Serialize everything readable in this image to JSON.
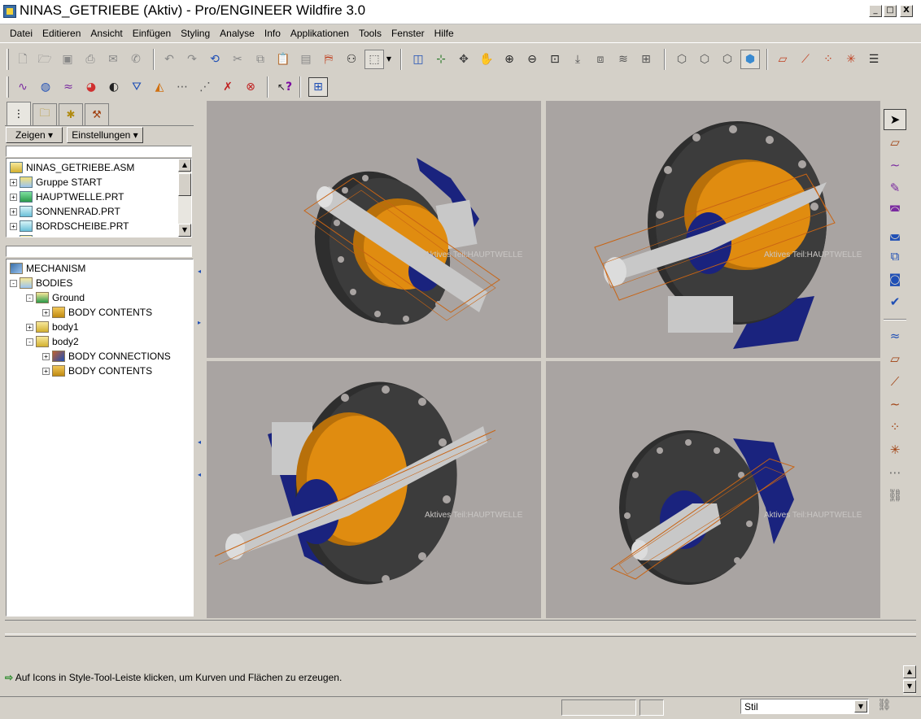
{
  "window": {
    "title": "NINAS_GETRIEBE (Aktiv) - Pro/ENGINEER Wildfire 3.0",
    "controls": [
      "_",
      "□",
      "X"
    ]
  },
  "menubar": [
    "Datei",
    "Editieren",
    "Ansicht",
    "Einfügen",
    "Styling",
    "Analyse",
    "Info",
    "Applikationen",
    "Tools",
    "Fenster",
    "Hilfe"
  ],
  "left_panel": {
    "show_button": "Zeigen",
    "settings_button": "Einstellungen",
    "model_tree": [
      {
        "label": "NINAS_GETRIEBE.ASM",
        "icon": "assembly-icon",
        "expander": ""
      },
      {
        "label": "Gruppe START",
        "icon": "group-icon",
        "expander": "+"
      },
      {
        "label": "HAUPTWELLE.PRT",
        "icon": "active-part-icon",
        "expander": "+"
      },
      {
        "label": "SONNENRAD.PRT",
        "icon": "part-icon",
        "expander": "+"
      },
      {
        "label": "BORDSCHEIBE.PRT",
        "icon": "part-icon",
        "expander": "+"
      },
      {
        "label": "BLAMMELE_ZAHNRAD.ASM",
        "icon": "assembly-icon",
        "expander": "+"
      }
    ],
    "mechanism_tree": [
      {
        "label": "MECHANISM",
        "icon": "mechanism-icon",
        "expander": "",
        "level": 0
      },
      {
        "label": "BODIES",
        "icon": "bodies-icon",
        "expander": "-",
        "level": 0
      },
      {
        "label": "Ground",
        "icon": "ground-icon",
        "expander": "-",
        "level": 1
      },
      {
        "label": "BODY CONTENTS",
        "icon": "body-contents-icon",
        "expander": "+",
        "level": 2
      },
      {
        "label": "body1",
        "icon": "body-icon",
        "expander": "+",
        "level": 1
      },
      {
        "label": "body2",
        "icon": "body-icon",
        "expander": "-",
        "level": 1
      },
      {
        "label": "BODY CONNECTIONS",
        "icon": "connection-icon",
        "expander": "+",
        "level": 2
      },
      {
        "label": "BODY CONTENTS",
        "icon": "body-contents-icon",
        "expander": "+",
        "level": 2
      }
    ]
  },
  "viewports": {
    "active_part_label": "Aktives Teil:HAUPTWELLE"
  },
  "message": {
    "text": "Auf Icons in Style-Tool-Leiste klicken, um Kurven und Flächen zu erzeugen."
  },
  "status": {
    "filter_value": "Stil"
  },
  "colors": {
    "highlight_circle": "#e02020",
    "flange": "#3c3c3c",
    "gear": "#e08c10",
    "bracket": "#1a237e",
    "shaft": "#c8c8c8",
    "viewport_bg": "#a9a4a2"
  }
}
